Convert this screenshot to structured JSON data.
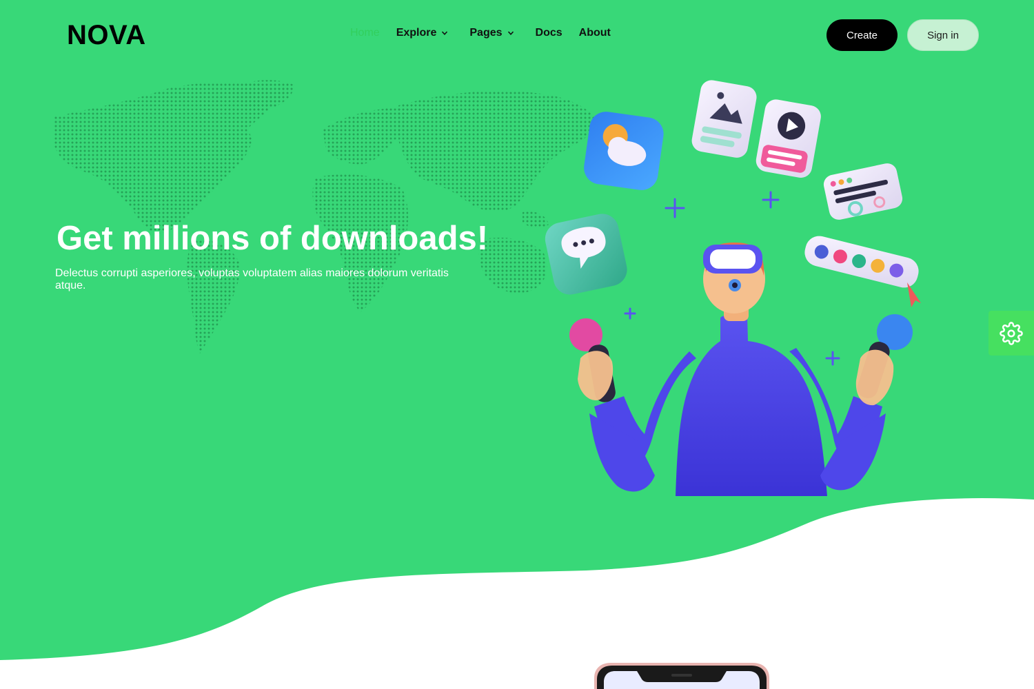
{
  "brand": {
    "logo": "NOVA"
  },
  "nav": {
    "items": [
      {
        "label": "Home",
        "active": true,
        "dropdown": false
      },
      {
        "label": "Explore",
        "active": false,
        "dropdown": true
      },
      {
        "label": "Pages",
        "active": false,
        "dropdown": true
      },
      {
        "label": "Docs",
        "active": false,
        "dropdown": false
      },
      {
        "label": "About",
        "active": false,
        "dropdown": false
      }
    ]
  },
  "header": {
    "create_label": "Create",
    "signin_label": "Sign in"
  },
  "hero": {
    "title": "Get millions of downloads!",
    "subtitle": "Delectus corrupti asperiores, voluptas voluptatem alias maiores dolorum veritatis atque."
  },
  "settings": {
    "icon": "gear-icon"
  },
  "colors": {
    "hero_green": "#38d878",
    "accent_green": "#32cf5d",
    "settings_green": "#46e060",
    "signin_bg": "#c6f1d3"
  }
}
